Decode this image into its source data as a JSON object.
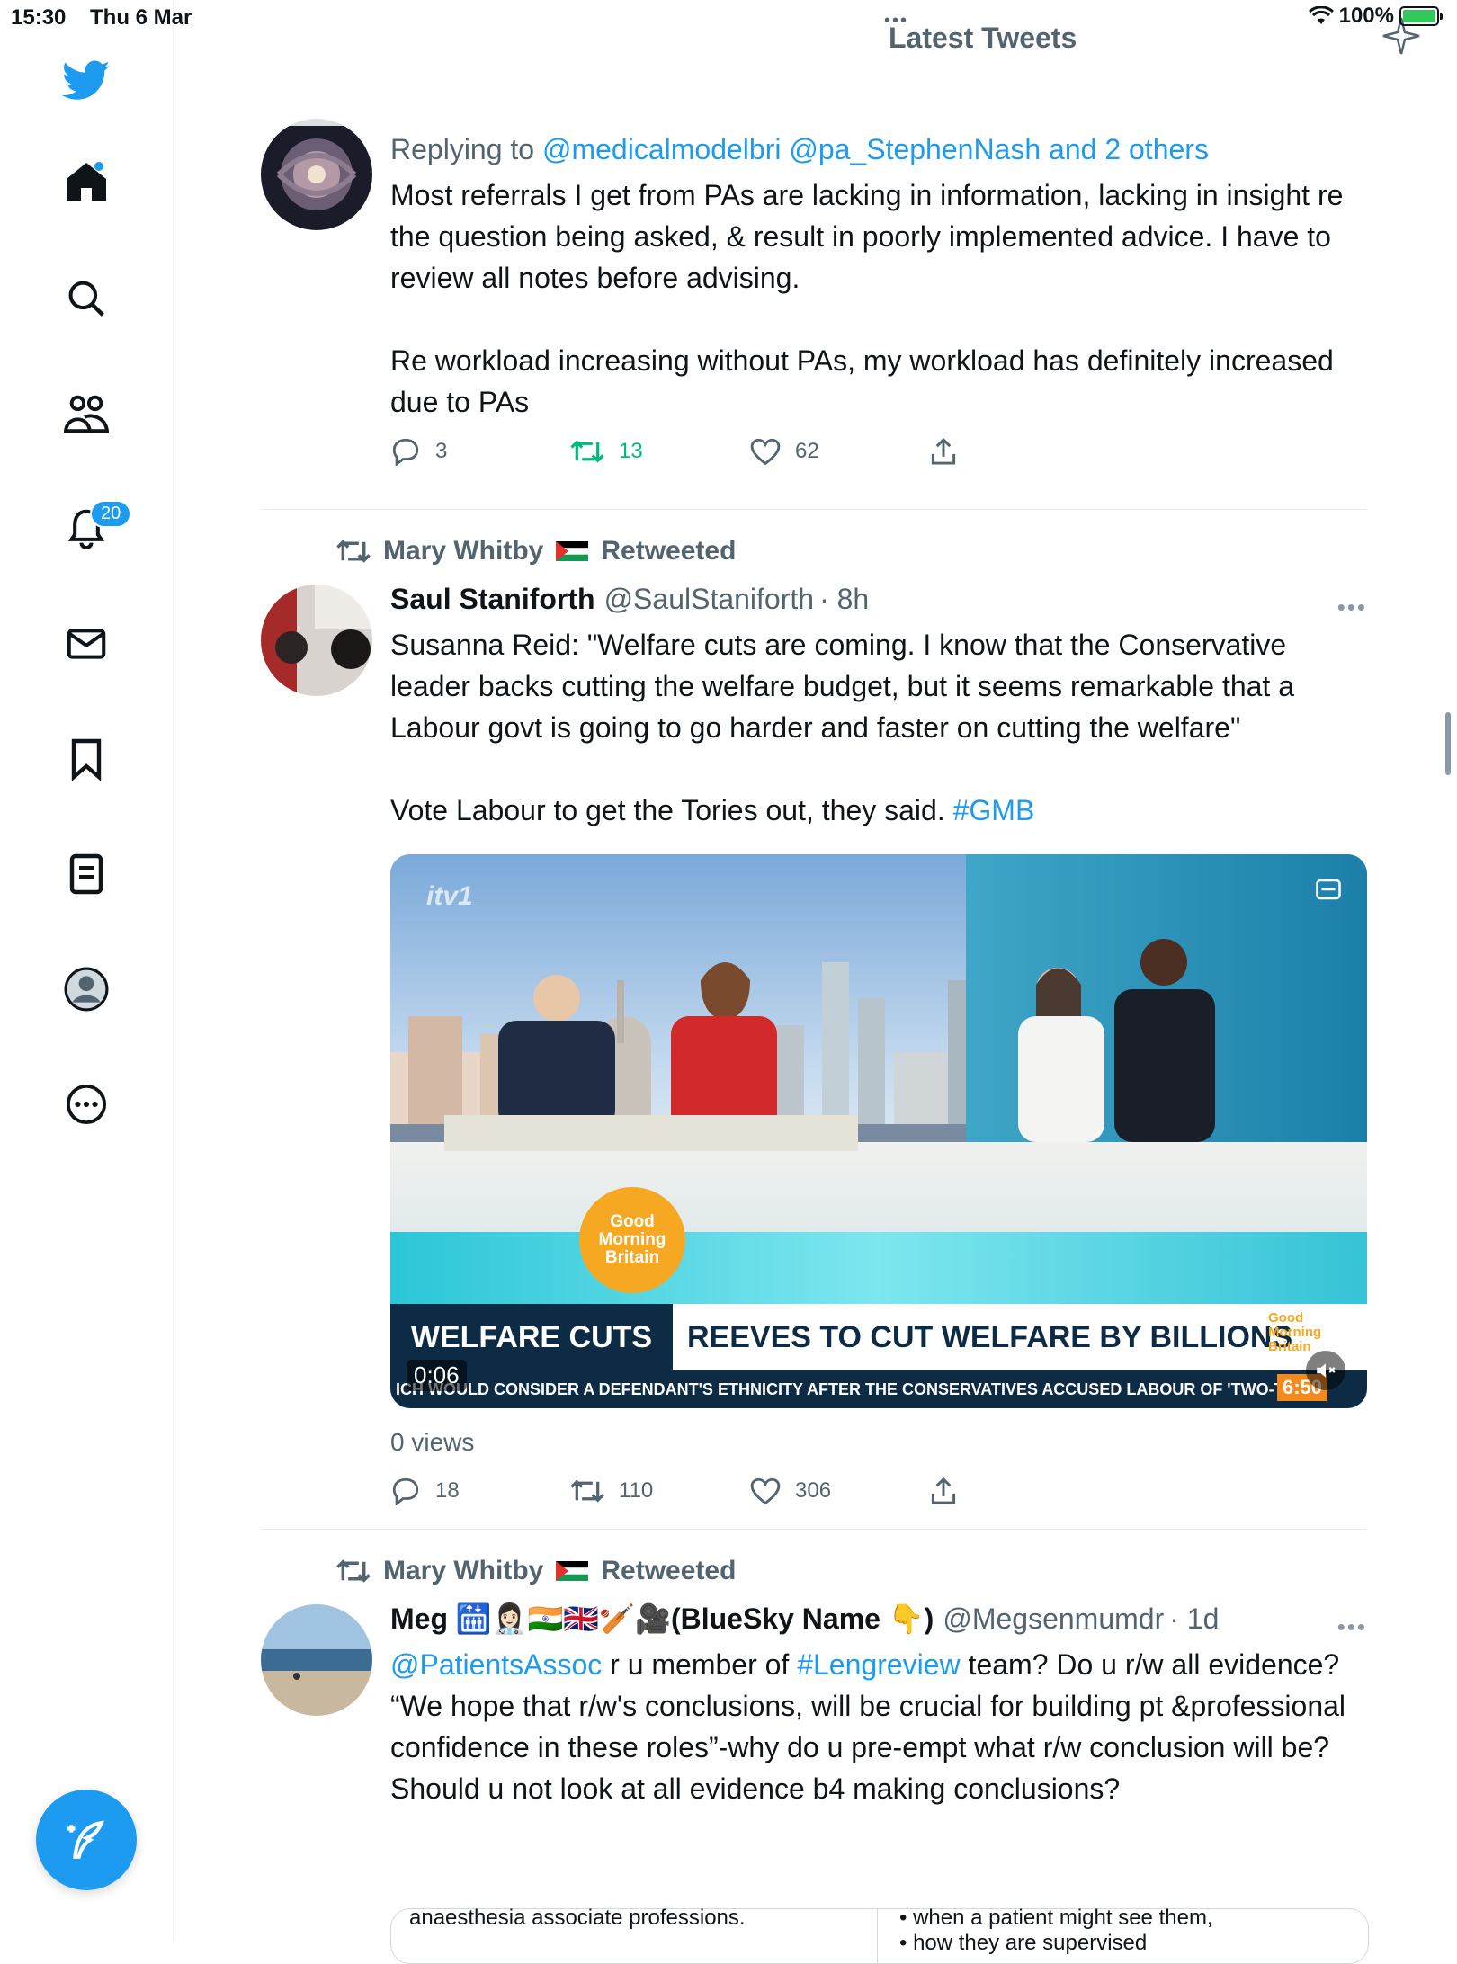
{
  "status_bar": {
    "time": "15:30",
    "date": "Thu 6 Mar",
    "battery": "100%",
    "battery_level": 1.0
  },
  "header": {
    "title": "Latest Tweets",
    "dots": "•••"
  },
  "sidebar": {
    "items": [
      {
        "name": "twitter-logo-icon"
      },
      {
        "name": "home-icon"
      },
      {
        "name": "search-icon"
      },
      {
        "name": "communities-icon"
      },
      {
        "name": "notifications-icon"
      },
      {
        "name": "messages-icon"
      },
      {
        "name": "bookmarks-icon"
      },
      {
        "name": "lists-icon"
      },
      {
        "name": "profile-icon"
      },
      {
        "name": "more-icon"
      }
    ],
    "notification_count": "20"
  },
  "tweets": [
    {
      "reply_prefix": "Replying to",
      "reply_users": "@medicalmodelbri @pa_StephenNash",
      "reply_and": "and 2 others",
      "text": "Most referrals I get from PAs are lacking in information, lacking in insight re the question being asked, & result in poorly implemented advice. I have to review all notes before advising.\n\nRe workload increasing without PAs, my workload has definitely increased due to PAs",
      "replies": "3",
      "retweets": "13",
      "likes": "62"
    },
    {
      "retweeted_by": "Mary Whitby",
      "retweeted_label": "Retweeted",
      "name": "Saul Staniforth",
      "handle": "@SaulStaniforth",
      "time": "· 8h",
      "more": "•••",
      "text_main": "Susanna Reid: \"Welfare cuts are coming. I know that the Conservative leader backs cutting the welfare budget, but it seems remarkable that a Labour govt is going to go harder and faster on cutting the welfare\"\n\nVote Labour to get the Tories out, they said. ",
      "hashtag": "#GMB",
      "media": {
        "itv": "itv1",
        "logo_text": "Good Morning Britain",
        "ticker_left": "WELFARE CUTS",
        "ticker_right": "REEVES TO CUT WELFARE BY BILLIONS",
        "ticker_logo": "Good Morning Britain",
        "ticker_small": "ICH WOULD CONSIDER A DEFENDANT'S ETHNICITY AFTER THE CONSERVATIVES ACCUSED LABOUR OF 'TWO-TI",
        "ticker_time": "6:50",
        "duration": "0:06"
      },
      "views": "0 views",
      "replies": "18",
      "retweets": "110",
      "likes": "306"
    },
    {
      "retweeted_by": "Mary Whitby",
      "retweeted_label": "Retweeted",
      "name": "Meg 🛗👩🏻‍⚕️🇮🇳🇬🇧🏏🎥(BlueSky Name 👇)",
      "handle": "@Megsenmumdr",
      "time": "· 1d",
      "more": "•••",
      "mention": "@PatientsAssoc",
      "text_a": " r u member of ",
      "hashtag": "#Lengreview",
      "text_b": " team? Do u r/w all evidence?\n“We hope that r/w's conclusions, will be crucial for building pt &professional confidence in these roles”-why do u pre-empt what r/w conclusion will be? Should u not look at all evidence b4 making conclusions?",
      "card_left": "anaesthesia associate professions.",
      "card_right_1": "• when a patient might see them,",
      "card_right_2": "• how they are supervised"
    }
  ],
  "colors": {
    "accent": "#1d9bf0",
    "retweet_green": "#00ba7c",
    "secondary_text": "#536471"
  }
}
